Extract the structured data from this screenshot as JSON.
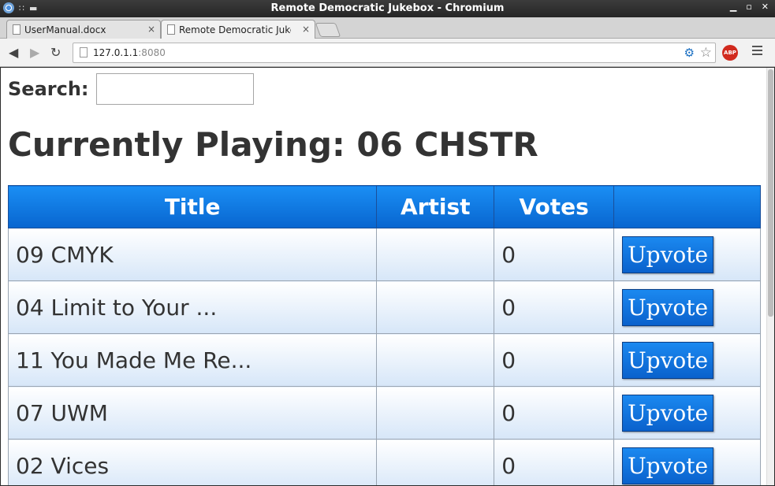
{
  "window": {
    "title": "Remote Democratic Jukebox - Chromium"
  },
  "tabs": [
    {
      "label": "UserManual.docx",
      "close": "×"
    },
    {
      "label": "Remote Democratic Jukeb",
      "close": "×"
    }
  ],
  "toolbar": {
    "url_host": "127.0.1.1",
    "url_port": ":8080",
    "abp_label": "ABP"
  },
  "page": {
    "search_label": "Search:",
    "search_value": "",
    "now_playing": "Currently Playing: 06 CHSTR",
    "columns": {
      "title": "Title",
      "artist": "Artist",
      "votes": "Votes",
      "action": ""
    },
    "upvote_label": "Upvote",
    "songs": [
      {
        "title": "09 CMYK",
        "artist": "",
        "votes": "0"
      },
      {
        "title": "04 Limit to Your ...",
        "artist": "",
        "votes": "0"
      },
      {
        "title": "11 You Made Me Re...",
        "artist": "",
        "votes": "0"
      },
      {
        "title": "07 UWM",
        "artist": "",
        "votes": "0"
      },
      {
        "title": "02 Vices",
        "artist": "",
        "votes": "0"
      }
    ]
  },
  "colors": {
    "header_blue": "#0a6ad6",
    "button_blue": "#1279e3",
    "row_gradient_end": "#d6e6f8"
  }
}
